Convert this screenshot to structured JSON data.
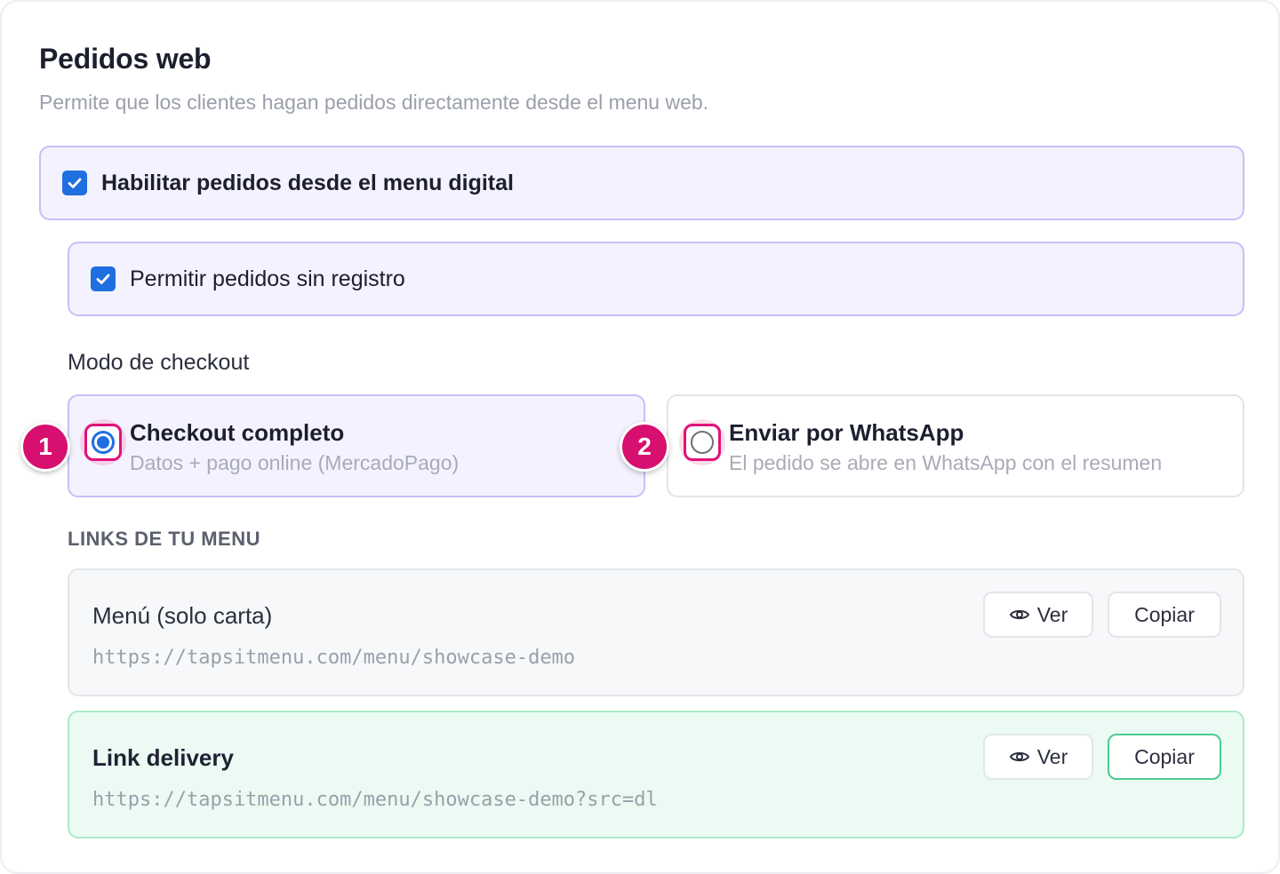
{
  "header": {
    "title": "Pedidos web",
    "subtitle": "Permite que los clientes hagan pedidos directamente desde el menu web."
  },
  "options": {
    "enable_orders": {
      "label": "Habilitar pedidos desde el menu digital",
      "checked": true
    },
    "guest_orders": {
      "label": "Permitir pedidos sin registro",
      "checked": true
    }
  },
  "checkout": {
    "label": "Modo de checkout",
    "modes": [
      {
        "badge": "1",
        "title": "Checkout completo",
        "description": "Datos + pago online (MercadoPago)",
        "selected": true
      },
      {
        "badge": "2",
        "title": "Enviar por WhatsApp",
        "description": "El pedido se abre en WhatsApp con el resumen",
        "selected": false
      }
    ]
  },
  "links": {
    "label": "LINKS DE TU MENU",
    "items": [
      {
        "name": "Menú (solo carta)",
        "url": "https://tapsitmenu.com/menu/showcase-demo",
        "view_label": "Ver",
        "copy_label": "Copiar"
      },
      {
        "name": "Link delivery",
        "url": "https://tapsitmenu.com/menu/showcase-demo?src=dl",
        "view_label": "Ver",
        "copy_label": "Copiar"
      }
    ]
  },
  "colors": {
    "accent": "#1f6fe0",
    "badge": "#d70f6e",
    "selected_bg": "#f4f2fe",
    "delivery_bg": "#ebfbf3"
  }
}
